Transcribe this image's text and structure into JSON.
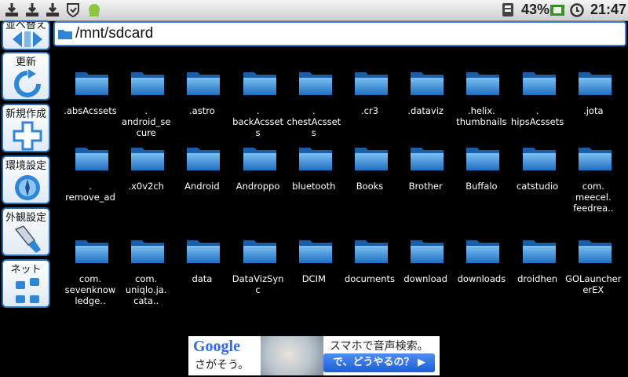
{
  "status_bar": {
    "battery_percent": "43%",
    "time": "21:47",
    "icons": [
      "download-icon",
      "download-icon",
      "download-icon",
      "shield-icon",
      "android-icon",
      "signal-icon",
      "battery-icon",
      "alarm-icon"
    ]
  },
  "sidebar": {
    "items": [
      {
        "label": "並べ替え",
        "icon": "sort-icon"
      },
      {
        "label": "更新",
        "icon": "refresh-icon"
      },
      {
        "label": "新規作成",
        "icon": "plus-icon"
      },
      {
        "label": "環境設定",
        "icon": "compass-icon"
      },
      {
        "label": "外観設定",
        "icon": "brush-icon"
      },
      {
        "label": "ネット",
        "icon": "network-icon"
      }
    ]
  },
  "path": {
    "text": "/mnt/sdcard"
  },
  "files": [
    ".absAcssets",
    ".\nandroid_se\ncure",
    ".astro",
    ".\nbackAcsset\ns",
    ".\nchestAcsset\ns",
    ".cr3",
    ".dataviz",
    ".helix.\nthumbnails",
    ".\nhipsAcssets",
    ".jota",
    ".\nremove_ad",
    ".x0v2ch",
    "Android",
    "Androppo",
    "bluetooth",
    "Books",
    "Brother",
    "Buffalo",
    "catstudio",
    "com.\nmeecel.\nfeedrea..",
    "com.\nsevenknow\nledge..",
    "com.\nuniqlo.ja.\ncata..",
    "data",
    "DataVizSyn\nc",
    "DCIM",
    "documents",
    "download",
    "downloads",
    "droidhen",
    "GOLauncher\nerEX"
  ],
  "ad": {
    "brand": "Google",
    "sub": "さがそう。",
    "headline": "スマホで音声検索。",
    "button": "で、どうやるの？ ▶"
  },
  "colors": {
    "accent": "#2b6fb8",
    "folder": "#2f86d6"
  }
}
